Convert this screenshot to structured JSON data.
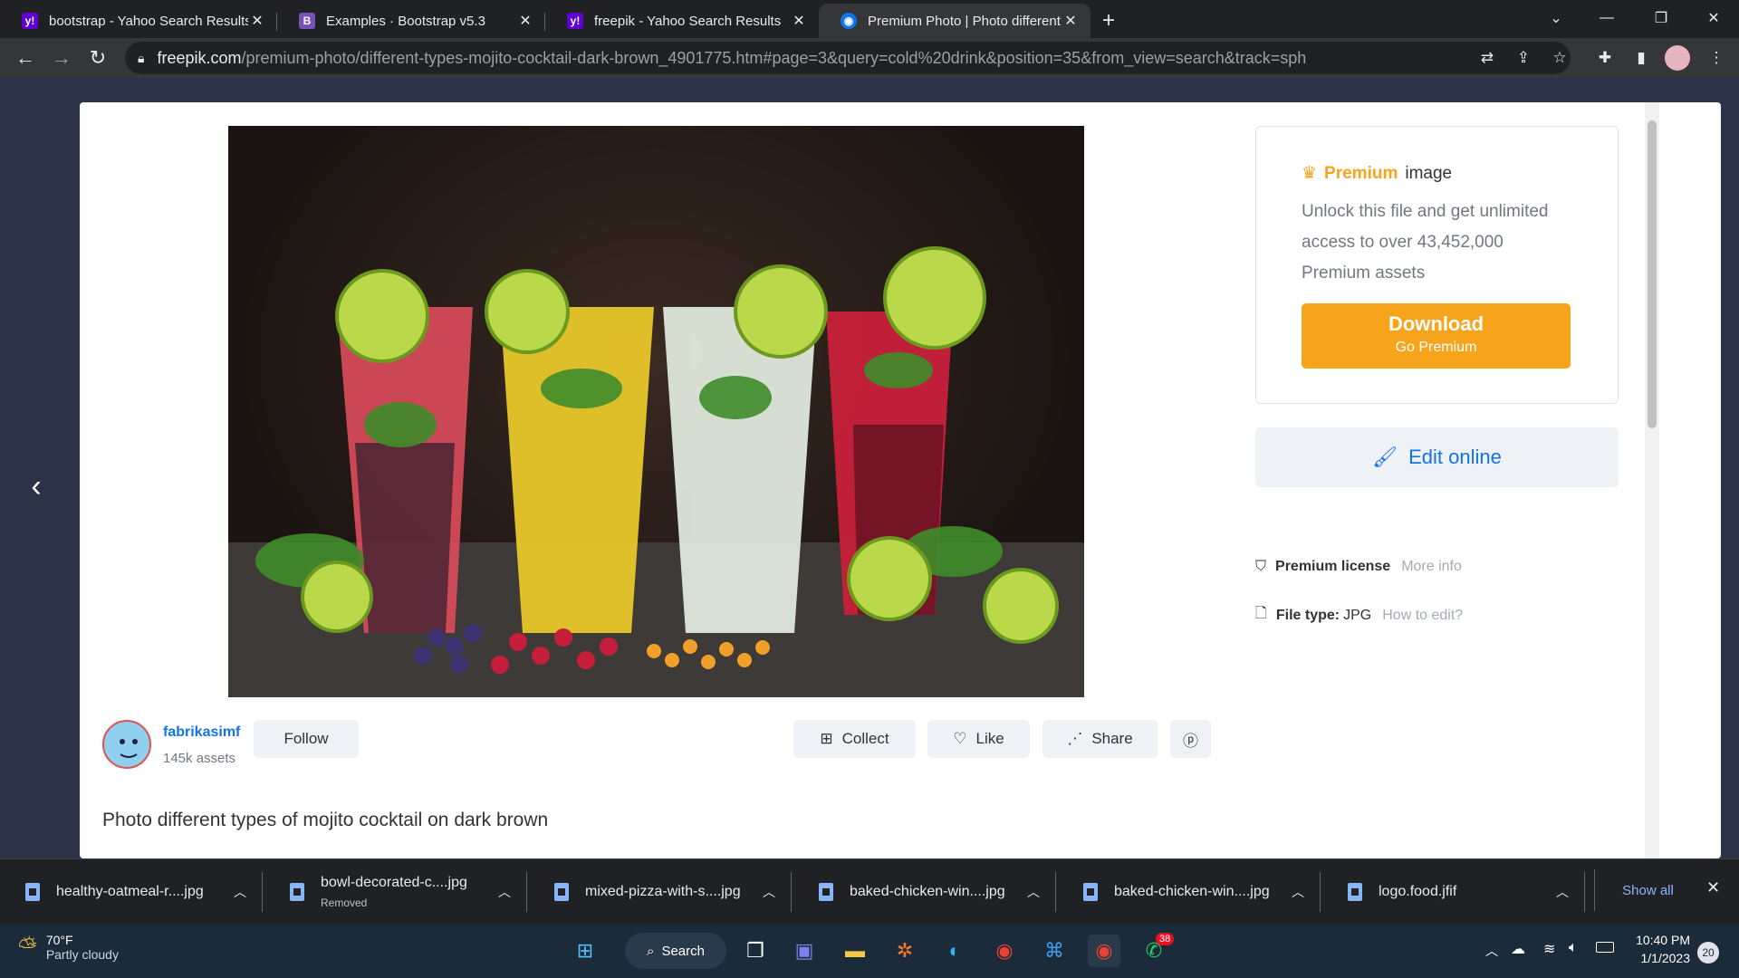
{
  "browser": {
    "tabs": [
      {
        "title": "bootstrap - Yahoo Search Results",
        "favicon": "yahoo-icon"
      },
      {
        "title": "Examples · Bootstrap v5.3",
        "favicon": "bootstrap-icon"
      },
      {
        "title": "freepik - Yahoo Search Results",
        "favicon": "yahoo-icon"
      },
      {
        "title": "Premium Photo | Photo different",
        "favicon": "freepik-icon",
        "active": true
      }
    ],
    "url_host": "freepik.com",
    "url_path": "/premium-photo/different-types-mojito-cocktail-dark-brown_4901775.htm#page=3&query=cold%20drink&position=35&from_view=search&track=sph"
  },
  "premium_card": {
    "badge": "Premium",
    "badge_suffix": "image",
    "description": "Unlock this file and get unlimited access to over 43,452,000 Premium assets",
    "download_label": "Download",
    "download_sub": "Go Premium"
  },
  "edit_online": "Edit online",
  "license": {
    "label": "Premium license",
    "link": "More info"
  },
  "filetype": {
    "label": "File type:",
    "value": "JPG",
    "link": "How to edit?"
  },
  "author": {
    "name": "fabrikasimf",
    "assets": "145k assets",
    "follow": "Follow"
  },
  "actions": {
    "collect": "Collect",
    "like": "Like",
    "share": "Share"
  },
  "photo_title": "Photo different types of mojito cocktail on dark brown",
  "downloads": [
    {
      "name": "healthy-oatmeal-r....jpg",
      "sub": ""
    },
    {
      "name": "bowl-decorated-c....jpg",
      "sub": "Removed"
    },
    {
      "name": "mixed-pizza-with-s....jpg",
      "sub": ""
    },
    {
      "name": "baked-chicken-win....jpg",
      "sub": ""
    },
    {
      "name": "baked-chicken-win....jpg",
      "sub": ""
    },
    {
      "name": "logo.food.jfif",
      "sub": ""
    }
  ],
  "show_all": "Show all",
  "taskbar": {
    "weather_temp": "70°F",
    "weather_desc": "Partly cloudy",
    "search": "Search",
    "time": "10:40 PM",
    "date": "1/1/2023",
    "whatsapp_badge": "38",
    "notif_count": "20"
  },
  "colors": {
    "premium": "#f7a41d",
    "link": "#1273eb",
    "chrome_dark": "#202124"
  }
}
